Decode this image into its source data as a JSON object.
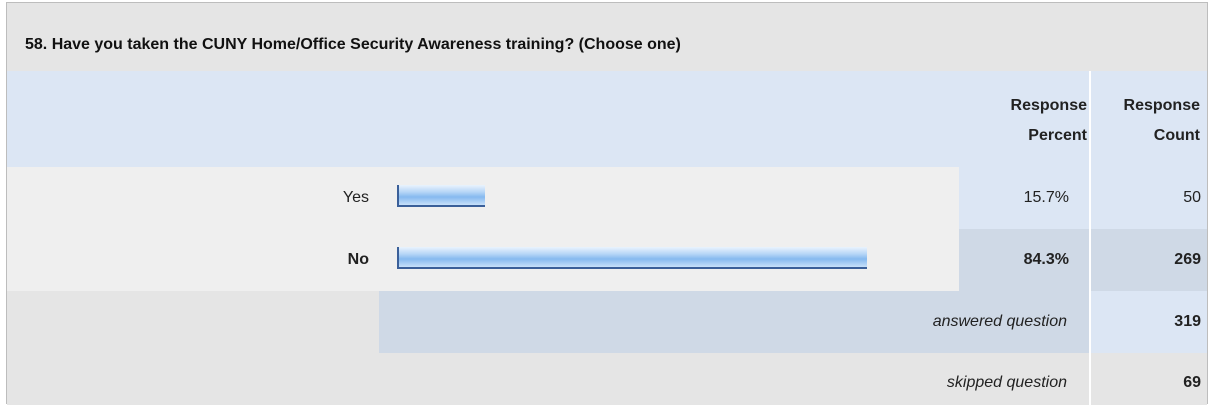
{
  "question": {
    "title": "58. Have you taken the CUNY Home/Office Security Awareness training? (Choose one)"
  },
  "headers": {
    "response_percent": [
      "Response",
      "Percent"
    ],
    "response_count": [
      "Response",
      "Count"
    ]
  },
  "options": [
    {
      "label": "Yes",
      "percent_text": "15.7%",
      "percent": 15.7,
      "count": "50"
    },
    {
      "label": "No",
      "percent_text": "84.3%",
      "percent": 84.3,
      "count": "269"
    }
  ],
  "summary": {
    "answered_label": "answered question",
    "answered_count": "319",
    "skipped_label": "skipped question",
    "skipped_count": "69"
  },
  "colors": {
    "bar_border": "#3a5f99",
    "bar_fill": "#86b9ef",
    "header_bg": "#dce6f4",
    "title_bg": "#e5e5e5"
  },
  "chart_data": {
    "type": "bar",
    "categories": [
      "Yes",
      "No"
    ],
    "values": [
      15.7,
      84.3
    ],
    "counts": [
      50,
      269
    ]
  }
}
